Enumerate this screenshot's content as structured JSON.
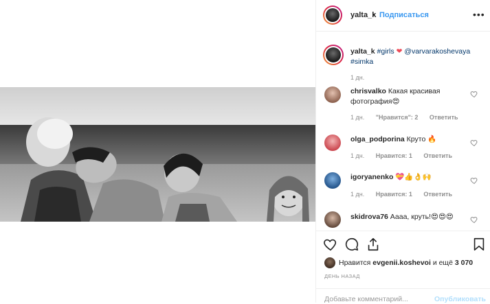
{
  "colors": {
    "link": "#3897f0",
    "hashtag": "#003569",
    "muted": "#8e8e8e",
    "heart": "#ed4956",
    "publish_disabled": "#b2dffc"
  },
  "header": {
    "username": "yalta_k",
    "separator": "•",
    "follow_label": "Подписаться",
    "more_label": "•••"
  },
  "caption": {
    "username": "yalta_k",
    "tag1": "#girls",
    "heart": "❤",
    "mention": "@varvarakoshevaya",
    "tag2": "#simka",
    "time": "1 дн."
  },
  "comments": [
    {
      "username": "chrisvalko",
      "text": "Какая красивая фотография😍",
      "time": "1 дн.",
      "likes": "\"Нравится\": 2",
      "reply": "Ответить"
    },
    {
      "username": "olga_podporina",
      "text": "Круто 🔥",
      "time": "1 дн.",
      "likes": "Нравится: 1",
      "reply": "Ответить"
    },
    {
      "username": "igoryanenko",
      "text": "💝👍👌🙌",
      "time": "1 дн.",
      "likes": "Нравится: 1",
      "reply": "Ответить"
    },
    {
      "username": "skidrova76",
      "text": "Аааа, круть!😍😍😍",
      "time": "",
      "likes": "",
      "reply": ""
    }
  ],
  "actions": {
    "icons": [
      "heart-icon",
      "comment-icon",
      "share-icon",
      "bookmark-icon"
    ],
    "liked_prefix": "Нравится",
    "liked_user": "evgenii.koshevoi",
    "liked_middle": "и ещё",
    "liked_count": "3 070",
    "date": "ДЕНЬ НАЗАД"
  },
  "add_comment": {
    "placeholder": "Добавьте комментарий...",
    "publish_label": "Опубликовать"
  }
}
